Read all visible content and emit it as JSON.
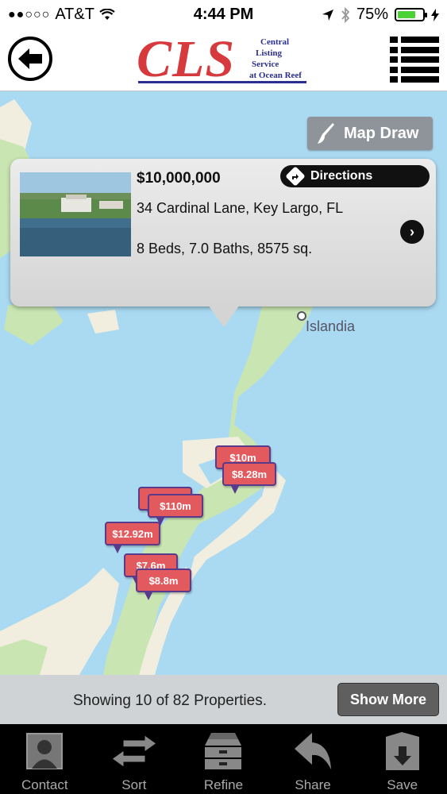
{
  "status_bar": {
    "carrier": "AT&T",
    "signal_dots": "●●○○○",
    "time": "4:44 PM",
    "battery_percent": "75%",
    "battery_level": 0.75
  },
  "header": {
    "logo_text": "CLS",
    "logo_subtitle": [
      "Central",
      "Listing",
      "Service",
      "at Ocean Reef"
    ]
  },
  "map": {
    "map_draw_label": "Map Draw",
    "place_label": "Islandia",
    "popup": {
      "price": "$10,000,000",
      "address": "34 Cardinal Lane, Key Largo, FL",
      "details": "8 Beds, 7.0 Baths, 8575 sq.",
      "directions_label": "Directions"
    },
    "markers": [
      {
        "label": "$10m"
      },
      {
        "label": "$8.28m"
      },
      {
        "label": ""
      },
      {
        "label": "$110m"
      },
      {
        "label": "$12.92m"
      },
      {
        "label": "$7.6m"
      },
      {
        "label": "$8.8m"
      }
    ]
  },
  "footer": {
    "showing_text": "Showing 10 of 82 Properties.",
    "show_more_label": "Show More"
  },
  "tabs": [
    {
      "label": "Contact",
      "icon": "contact-icon"
    },
    {
      "label": "Sort",
      "icon": "sort-icon"
    },
    {
      "label": "Refine",
      "icon": "refine-icon"
    },
    {
      "label": "Share",
      "icon": "share-icon"
    },
    {
      "label": "Save",
      "icon": "save-icon"
    }
  ],
  "colors": {
    "brand_red": "#d63a3d",
    "brand_blue": "#2b2f8f",
    "marker": "#e35a5e",
    "water": "#aadaf2",
    "land": "#f2eedf",
    "park": "#c9e6b2"
  }
}
